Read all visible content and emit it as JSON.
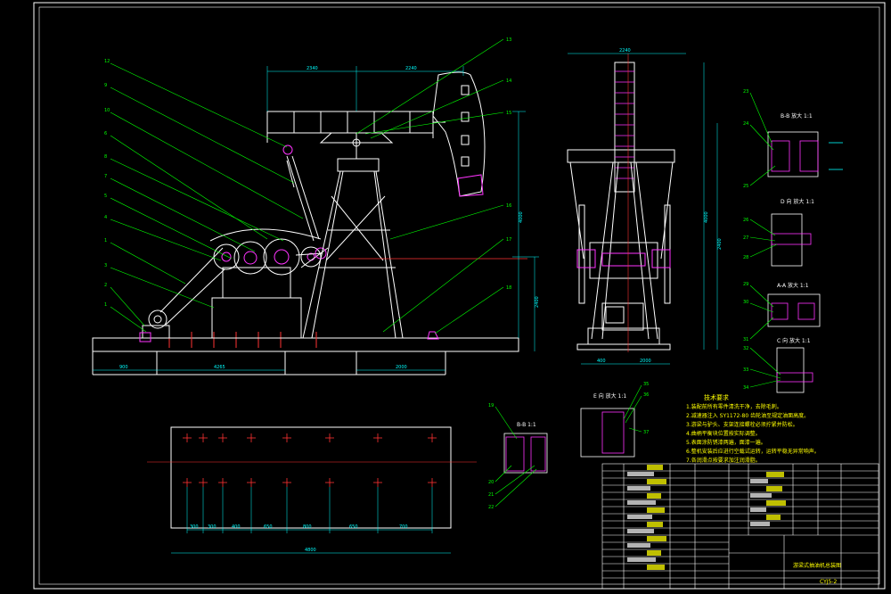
{
  "drawing": {
    "colors": {
      "background": "#000000",
      "frame": "#ffffff",
      "outline": "#ffffff",
      "leader": "#00ff00",
      "dimension": "#00ffff",
      "highlight": "#ff33ff",
      "centerline": "#ff0000",
      "notes": "#ffff00"
    },
    "main_view": {
      "dims_top": [
        "2340",
        "2240"
      ],
      "dims_right": [
        "4000",
        "2400"
      ],
      "dims_bottom": [
        "900",
        "4265",
        "2000"
      ],
      "balloons_left": [
        "12",
        "9",
        "10",
        "6",
        "8",
        "7",
        "5",
        "4",
        "1",
        "3",
        "2",
        "1"
      ],
      "balloons_right": [
        "13",
        "14",
        "15",
        "16",
        "17",
        "18"
      ]
    },
    "side_view": {
      "dim_top": "2240",
      "dims_right": [
        "4000",
        "2400"
      ],
      "dims_bottom": [
        "400",
        "2000"
      ]
    },
    "base_plan": {
      "dims_bottom": [
        "300",
        "300",
        "400",
        "650",
        "800",
        "650",
        "700"
      ],
      "dim_total": "4800"
    },
    "detail_views": [
      {
        "title": "B-B  放大 1:1",
        "balloons": [
          "23",
          "24",
          "25"
        ]
      },
      {
        "title": "D 向  放大 1:1",
        "balloons": [
          "26",
          "27",
          "28"
        ]
      },
      {
        "title": "A-A  放大 1:1",
        "balloons": [
          "29",
          "30",
          "31"
        ]
      },
      {
        "title": "C 向  放大 1:1",
        "balloons": [
          "32",
          "33",
          "34"
        ]
      },
      {
        "title": "E 向  放大 1:1",
        "balloons": [
          "35",
          "36",
          "37"
        ]
      },
      {
        "title": "B-B  1:1",
        "balloons": [
          "19",
          "20",
          "21",
          "22"
        ]
      }
    ],
    "tech_requirements": {
      "heading": "技术要求",
      "lines": [
        "1.装配前所有零件清洗干净，去除毛刺。",
        "2.减速器注入 SY1172-80 齿轮油至规定油面高度。",
        "3.游梁与驴头、支架连接螺栓必须拧紧并防松。",
        "4.曲柄平衡块位置按实际调整。",
        "5.表面涂防锈漆两遍，面漆一遍。",
        "6.整机安装后应进行空载试运转，运转平稳无异常响声。",
        "7.各润滑点按要求加注润滑脂。"
      ]
    },
    "title_block": {
      "drawing_title": "游梁式抽油机总装图",
      "drawing_number": "CYJ5-2"
    }
  }
}
